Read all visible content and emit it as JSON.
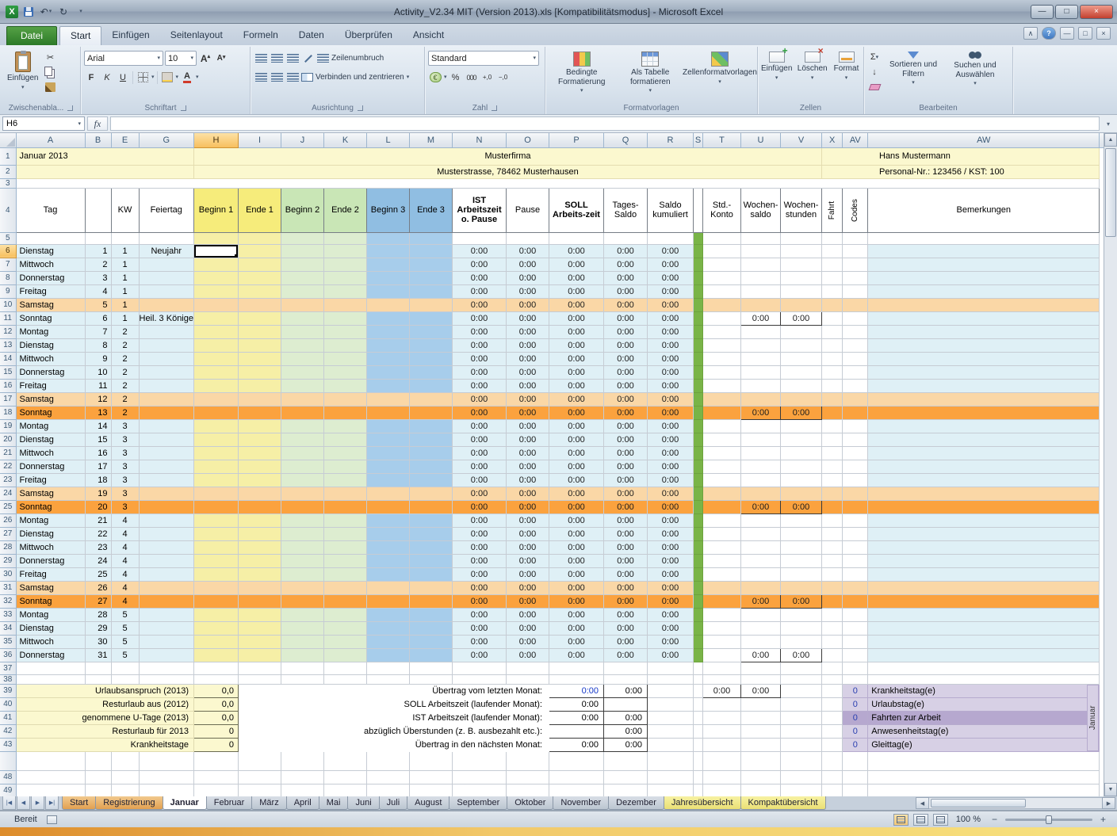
{
  "titlebar": {
    "title": "Activity_V2.34 MIT (Version 2013).xls  [Kompatibilitätsmodus]  -  Microsoft Excel"
  },
  "ribbon": {
    "file_tab": "Datei",
    "tabs": [
      "Start",
      "Einfügen",
      "Seitenlayout",
      "Formeln",
      "Daten",
      "Überprüfen",
      "Ansicht"
    ],
    "active_tab": "Start",
    "font_name": "Arial",
    "font_size": "10",
    "number_format": "Standard",
    "icons": {
      "bold": "F",
      "italic": "K",
      "underline": "U",
      "percent": "%",
      "thousands": "000",
      "autosum": "Σ",
      "currency": "€",
      "undo": "↶",
      "redo": "↻",
      "inc_decimal": "+,0",
      "dec_decimal": "−,0",
      "fill_down": "↓"
    },
    "labels": {
      "paste": "Einfügen",
      "clipboard_group": "Zwischenabla...",
      "font_group": "Schriftart",
      "wrap_text": "Zeilenumbruch",
      "merge_center": "Verbinden und zentrieren",
      "alignment_group": "Ausrichtung",
      "number_group": "Zahl",
      "conditional_formatting": "Bedingte Formatierung",
      "format_as_table": "Als Tabelle formatieren",
      "cell_styles": "Zellenformatvorlagen",
      "styles_group": "Formatvorlagen",
      "insert_cells": "Einfügen",
      "delete_cells": "Löschen",
      "format_cells": "Format",
      "cells_group": "Zellen",
      "sort_filter": "Sortieren und Filtern",
      "find_select": "Suchen und Auswählen",
      "editing_group": "Bearbeiten"
    }
  },
  "formula_bar": {
    "name_box": "H6",
    "fx": "fx"
  },
  "selected": {
    "cell": "H6",
    "column": "H",
    "row": 6
  },
  "columns": [
    "A",
    "B",
    "E",
    "G",
    "H",
    "I",
    "J",
    "K",
    "L",
    "M",
    "N",
    "O",
    "P",
    "Q",
    "R",
    "S",
    "T",
    "U",
    "V",
    "X",
    "AV",
    "AW"
  ],
  "header_info": {
    "month_title": "Januar 2013",
    "company": "Musterfirma",
    "address": "Musterstrasse, 78462 Musterhausen",
    "employee": "Hans Mustermann",
    "personal_no": "Personal-Nr.: 123456 / KST: 100"
  },
  "table_headers": [
    {
      "col": "A",
      "label": "Tag"
    },
    {
      "col": "B",
      "label": ""
    },
    {
      "col": "E",
      "label": "KW"
    },
    {
      "col": "G",
      "label": "Feiertag"
    },
    {
      "col": "H",
      "label": "Beginn 1",
      "color": "y"
    },
    {
      "col": "I",
      "label": "Ende 1",
      "color": "y"
    },
    {
      "col": "J",
      "label": "Beginn 2",
      "color": "g"
    },
    {
      "col": "K",
      "label": "Ende 2",
      "color": "g"
    },
    {
      "col": "L",
      "label": "Beginn 3",
      "color": "b"
    },
    {
      "col": "M",
      "label": "Ende 3",
      "color": "b"
    },
    {
      "col": "N",
      "label": "IST Arbeitszeit o. Pause",
      "bold": true
    },
    {
      "col": "O",
      "label": "Pause"
    },
    {
      "col": "P",
      "label": "SOLL Arbeits-zeit",
      "bold": true
    },
    {
      "col": "Q",
      "label": "Tages-Saldo"
    },
    {
      "col": "R",
      "label": "Saldo kumuliert"
    },
    {
      "col": "S",
      "label": ""
    },
    {
      "col": "T",
      "label": "Std.-Konto"
    },
    {
      "col": "U",
      "label": "Wochen-saldo"
    },
    {
      "col": "V",
      "label": "Wochen-stunden"
    },
    {
      "col": "X",
      "label": "Fahrt",
      "rotate": true
    },
    {
      "col": "AV",
      "label": "Codes",
      "rotate": true
    },
    {
      "col": "AW",
      "label": "Bemerkungen"
    }
  ],
  "default_day_times": [
    "0:00",
    "0:00",
    "0:00",
    "0:00",
    "0:00"
  ],
  "week_totals": [
    "0:00",
    "0:00"
  ],
  "days": [
    {
      "row": 6,
      "name": "Dienstag",
      "nr": "1",
      "kw": "1",
      "holiday": "Neujahr",
      "kind": "weekday",
      "week": false,
      "selected": true
    },
    {
      "row": 7,
      "name": "Mittwoch",
      "nr": "2",
      "kw": "1",
      "holiday": "",
      "kind": "weekday",
      "week": false
    },
    {
      "row": 8,
      "name": "Donnerstag",
      "nr": "3",
      "kw": "1",
      "holiday": "",
      "kind": "weekday",
      "week": false
    },
    {
      "row": 9,
      "name": "Freitag",
      "nr": "4",
      "kw": "1",
      "holiday": "",
      "kind": "weekday",
      "week": false
    },
    {
      "row": 10,
      "name": "Samstag",
      "nr": "5",
      "kw": "1",
      "holiday": "",
      "kind": "samstag",
      "week": false
    },
    {
      "row": 11,
      "name": "Sonntag",
      "nr": "6",
      "kw": "1",
      "holiday": "Heil. 3 Könige",
      "kind": "weekday",
      "week": true
    },
    {
      "row": 12,
      "name": "Montag",
      "nr": "7",
      "kw": "2",
      "holiday": "",
      "kind": "weekday",
      "week": false
    },
    {
      "row": 13,
      "name": "Dienstag",
      "nr": "8",
      "kw": "2",
      "holiday": "",
      "kind": "weekday",
      "week": false
    },
    {
      "row": 14,
      "name": "Mittwoch",
      "nr": "9",
      "kw": "2",
      "holiday": "",
      "kind": "weekday",
      "week": false
    },
    {
      "row": 15,
      "name": "Donnerstag",
      "nr": "10",
      "kw": "2",
      "holiday": "",
      "kind": "weekday",
      "week": false
    },
    {
      "row": 16,
      "name": "Freitag",
      "nr": "11",
      "kw": "2",
      "holiday": "",
      "kind": "weekday",
      "week": false
    },
    {
      "row": 17,
      "name": "Samstag",
      "nr": "12",
      "kw": "2",
      "holiday": "",
      "kind": "samstag",
      "week": false
    },
    {
      "row": 18,
      "name": "Sonntag",
      "nr": "13",
      "kw": "2",
      "holiday": "",
      "kind": "sonntag",
      "week": true
    },
    {
      "row": 19,
      "name": "Montag",
      "nr": "14",
      "kw": "3",
      "holiday": "",
      "kind": "weekday",
      "week": false
    },
    {
      "row": 20,
      "name": "Dienstag",
      "nr": "15",
      "kw": "3",
      "holiday": "",
      "kind": "weekday",
      "week": false
    },
    {
      "row": 21,
      "name": "Mittwoch",
      "nr": "16",
      "kw": "3",
      "holiday": "",
      "kind": "weekday",
      "week": false
    },
    {
      "row": 22,
      "name": "Donnerstag",
      "nr": "17",
      "kw": "3",
      "holiday": "",
      "kind": "weekday",
      "week": false
    },
    {
      "row": 23,
      "name": "Freitag",
      "nr": "18",
      "kw": "3",
      "holiday": "",
      "kind": "weekday",
      "week": false
    },
    {
      "row": 24,
      "name": "Samstag",
      "nr": "19",
      "kw": "3",
      "holiday": "",
      "kind": "samstag",
      "week": false
    },
    {
      "row": 25,
      "name": "Sonntag",
      "nr": "20",
      "kw": "3",
      "holiday": "",
      "kind": "sonntag",
      "week": true
    },
    {
      "row": 26,
      "name": "Montag",
      "nr": "21",
      "kw": "4",
      "holiday": "",
      "kind": "weekday",
      "week": false
    },
    {
      "row": 27,
      "name": "Dienstag",
      "nr": "22",
      "kw": "4",
      "holiday": "",
      "kind": "weekday",
      "week": false
    },
    {
      "row": 28,
      "name": "Mittwoch",
      "nr": "23",
      "kw": "4",
      "holiday": "",
      "kind": "weekday",
      "week": false
    },
    {
      "row": 29,
      "name": "Donnerstag",
      "nr": "24",
      "kw": "4",
      "holiday": "",
      "kind": "weekday",
      "week": false
    },
    {
      "row": 30,
      "name": "Freitag",
      "nr": "25",
      "kw": "4",
      "holiday": "",
      "kind": "weekday",
      "week": false
    },
    {
      "row": 31,
      "name": "Samstag",
      "nr": "26",
      "kw": "4",
      "holiday": "",
      "kind": "samstag",
      "week": false
    },
    {
      "row": 32,
      "name": "Sonntag",
      "nr": "27",
      "kw": "4",
      "holiday": "",
      "kind": "sonntag",
      "week": true
    },
    {
      "row": 33,
      "name": "Montag",
      "nr": "28",
      "kw": "5",
      "holiday": "",
      "kind": "weekday",
      "week": false
    },
    {
      "row": 34,
      "name": "Dienstag",
      "nr": "29",
      "kw": "5",
      "holiday": "",
      "kind": "weekday",
      "week": false
    },
    {
      "row": 35,
      "name": "Mittwoch",
      "nr": "30",
      "kw": "5",
      "holiday": "",
      "kind": "weekday",
      "week": false
    },
    {
      "row": 36,
      "name": "Donnerstag",
      "nr": "31",
      "kw": "5",
      "holiday": "",
      "kind": "weekday",
      "week": true
    }
  ],
  "extra_rows": {
    "mid": [
      37,
      38
    ],
    "summary": [
      39,
      40,
      41,
      42,
      43
    ],
    "tail": [
      48,
      49
    ]
  },
  "summary_left": [
    {
      "label": "Urlaubsanspruch (2013)",
      "value": "0,0"
    },
    {
      "label": "Resturlaub aus (2012)",
      "value": "0,0"
    },
    {
      "label": "genommene U-Tage (2013)",
      "value": "0,0"
    },
    {
      "label": "Resturlaub für 2013",
      "value": "0"
    },
    {
      "label": "Krankheitstage",
      "value": "0"
    }
  ],
  "summary_mid": [
    {
      "label": "Übertrag vom letzten Monat:",
      "v1": "0:00",
      "v2": "0:00",
      "blue": true
    },
    {
      "label": "SOLL Arbeitszeit (laufender Monat):",
      "v1": "0:00",
      "v2": ""
    },
    {
      "label": "IST Arbeitszeit (laufender Monat):",
      "v1": "0:00",
      "v2": "0:00"
    },
    {
      "label": "abzüglich Überstunden (z. B. ausbezahlt etc.):",
      "v1": "",
      "v2": "0:00"
    },
    {
      "label": "Übertrag in den nächsten Monat:",
      "v1": "0:00",
      "v2": "0:00",
      "bold": true
    }
  ],
  "week_box": {
    "v1": "0:00",
    "v2": "0:00"
  },
  "summary_right": [
    {
      "value": "0",
      "label": "Krankheitstag(e)"
    },
    {
      "value": "0",
      "label": "Urlaubstag(e)"
    },
    {
      "value": "0",
      "label": "Fahrten zur Arbeit",
      "dark": true
    },
    {
      "value": "0",
      "label": "Anwesenheitstag(e)"
    },
    {
      "value": "0",
      "label": "Gleittag(e)"
    }
  ],
  "month_vertical": "Januar",
  "sheet_tabs": [
    {
      "label": "Start",
      "style": "orange"
    },
    {
      "label": "Registrierung",
      "style": "orange"
    },
    {
      "label": "Januar",
      "style": "active"
    },
    {
      "label": "Februar",
      "style": "gray"
    },
    {
      "label": "März",
      "style": "gray"
    },
    {
      "label": "April",
      "style": "gray"
    },
    {
      "label": "Mai",
      "style": "gray"
    },
    {
      "label": "Juni",
      "style": "gray"
    },
    {
      "label": "Juli",
      "style": "gray"
    },
    {
      "label": "August",
      "style": "gray"
    },
    {
      "label": "September",
      "style": "gray"
    },
    {
      "label": "Oktober",
      "style": "gray"
    },
    {
      "label": "November",
      "style": "gray"
    },
    {
      "label": "Dezember",
      "style": "gray"
    },
    {
      "label": "Jahresübersicht",
      "style": "yellow"
    },
    {
      "label": "Kompaktübersicht",
      "style": "yellow"
    }
  ],
  "status_bar": {
    "ready": "Bereit",
    "zoom": "100 %"
  }
}
